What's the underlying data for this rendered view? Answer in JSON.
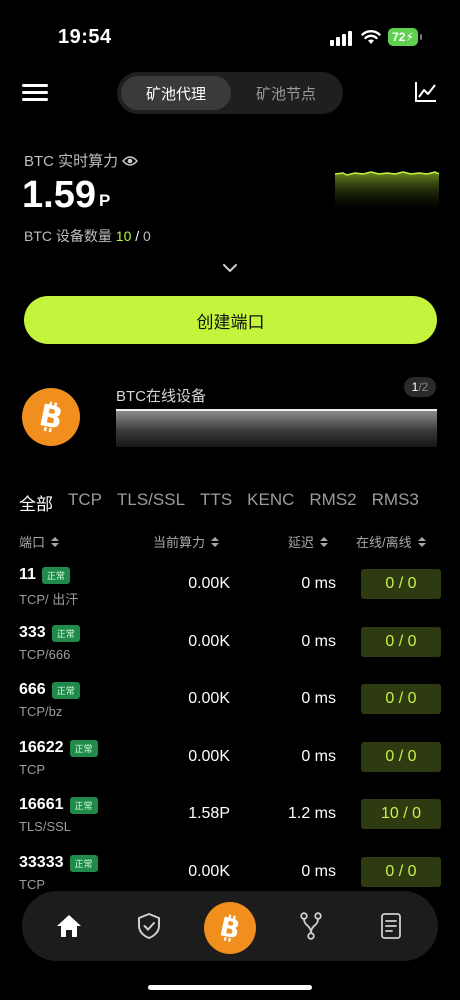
{
  "status_bar": {
    "time": "19:54",
    "battery": "72"
  },
  "nav": {
    "tabs": [
      {
        "label": "矿池代理",
        "active": true
      },
      {
        "label": "矿池节点",
        "active": false
      }
    ]
  },
  "hashrate": {
    "label": "BTC 实时算力",
    "value": "1.59",
    "unit": "P"
  },
  "devices": {
    "label": "BTC 设备数量",
    "online": "10",
    "separator": "/",
    "offline": "0"
  },
  "create_button": "创建端口",
  "online_devices": {
    "title": "BTC在线设备",
    "page_current": "1",
    "page_total": "/2"
  },
  "filters": [
    "全部",
    "TCP",
    "TLS/SSL",
    "TTS",
    "KENC",
    "RMS2",
    "RMS3"
  ],
  "table": {
    "headers": {
      "port": "端口",
      "hashrate": "当前算力",
      "latency": "延迟",
      "online": "在线/离线"
    },
    "rows": [
      {
        "port": "11",
        "status": "正常",
        "protocol": "TCP/ 出汗",
        "hashrate": "0.00K",
        "latency": "0 ms",
        "online": "0 / 0"
      },
      {
        "port": "333",
        "status": "正常",
        "protocol": "TCP/666",
        "hashrate": "0.00K",
        "latency": "0 ms",
        "online": "0 / 0"
      },
      {
        "port": "666",
        "status": "正常",
        "protocol": "TCP/bz",
        "hashrate": "0.00K",
        "latency": "0 ms",
        "online": "0 / 0"
      },
      {
        "port": "16622",
        "status": "正常",
        "protocol": "TCP",
        "hashrate": "0.00K",
        "latency": "0 ms",
        "online": "0 / 0"
      },
      {
        "port": "16661",
        "status": "正常",
        "protocol": "TLS/SSL",
        "hashrate": "1.58P",
        "latency": "1.2 ms",
        "online": "10 / 0"
      },
      {
        "port": "33333",
        "status": "正常",
        "protocol": "TCP",
        "hashrate": "0.00K",
        "latency": "0 ms",
        "online": "0 / 0"
      }
    ]
  },
  "bottom_nav": [
    "home-icon",
    "shield-check-icon",
    "bitcoin-icon",
    "fork-icon",
    "document-icon"
  ],
  "colors": {
    "accent": "#c4f53c",
    "bitcoin": "#f08f1e",
    "badge": "#1f8a4a"
  }
}
